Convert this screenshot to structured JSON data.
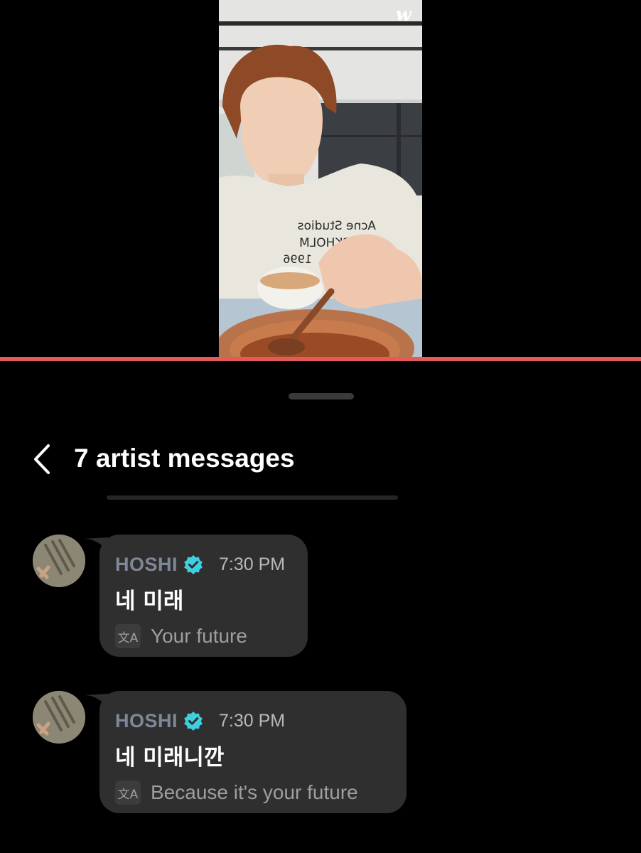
{
  "video": {
    "watermark": "w",
    "shirt_text": [
      "Acne Studios",
      "STOCKHOLM",
      "1996"
    ]
  },
  "header": {
    "title": "7 artist messages"
  },
  "messages": [
    {
      "artist": "HOSHI",
      "time": "7:30 PM",
      "text": "네 미래",
      "translation": "Your future"
    },
    {
      "artist": "HOSHI",
      "time": "7:30 PM",
      "text": "네 미래니깐",
      "translation": "Because it's your future"
    }
  ],
  "icons": {
    "back": "chevron-left-icon",
    "verified": "verified-badge-icon",
    "translate": "translate-icon"
  },
  "colors": {
    "accent_divider": "#e25a5a",
    "verified": "#3ecfe0",
    "bubble": "#2f2f2f",
    "artist_name": "#7f8798"
  }
}
